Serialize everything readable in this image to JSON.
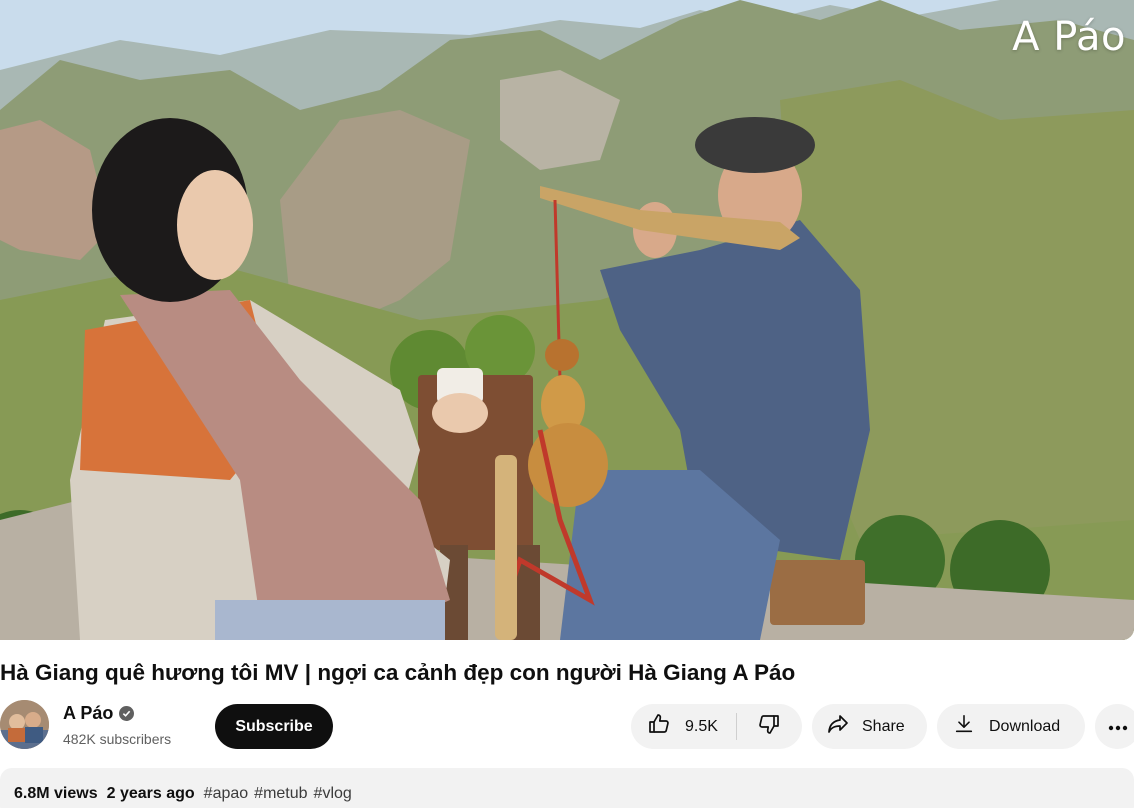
{
  "video": {
    "watermark": "A Páo"
  },
  "title": "Hà Giang quê hương tôi MV | ngợi ca cảnh đẹp con người Hà Giang A Páo",
  "channel": {
    "name": "A Páo",
    "subscribers": "482K subscribers",
    "avatar_icon": "channel-avatar",
    "verified_icon": "check-circle-icon"
  },
  "actions": {
    "subscribe_label": "Subscribe",
    "like_count": "9.5K",
    "like_icon": "thumbs-up-icon",
    "dislike_icon": "thumbs-down-icon",
    "share_label": "Share",
    "share_icon": "share-arrow-icon",
    "download_label": "Download",
    "download_icon": "download-icon",
    "more_icon": "more-horizontal-icon"
  },
  "description": {
    "views": "6.8M views",
    "age": "2 years ago",
    "hashtags": [
      "#apao",
      "#metub",
      "#vlog"
    ]
  },
  "colors": {
    "subscribe_bg": "#0f0f0f",
    "pill_bg": "#f2f2f2",
    "secondary_text": "#606060"
  }
}
